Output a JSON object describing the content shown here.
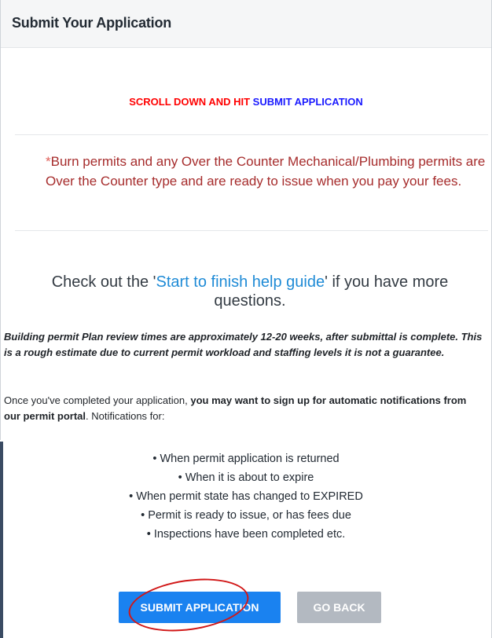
{
  "header": {
    "title": "Submit Your Application"
  },
  "instruction": {
    "red_text": "SCROLL DOWN AND HIT ",
    "blue_text": "SUBMIT APPLICATION"
  },
  "note": {
    "asterisk": "*",
    "text": "Burn permits and any Over the Counter Mechanical/Plumbing permits are Over the Counter type and are ready to issue when you pay your fees."
  },
  "help": {
    "prefix": "Check out the '",
    "link_text": "Start to finish help guide",
    "suffix": "' if you have more questions."
  },
  "review_notice": "Building permit Plan review times are approximately 12-20 weeks, after submittal is complete. This is a rough estimate due to current permit workload and staffing levels it is not a guarantee.",
  "signup": {
    "prefix": "Once you've completed your application, ",
    "bold": "you may want to sign up for automatic notifications from our permit portal",
    "suffix": ". Notifications for:"
  },
  "notifications": [
    "When permit application is returned",
    "When it is about to expire",
    "When permit state has changed to EXPIRED",
    "Permit is ready to issue, or has fees due",
    "Inspections have been completed etc."
  ],
  "buttons": {
    "submit": "SUBMIT APPLICATION",
    "back": "GO BACK"
  },
  "colors": {
    "instruction_red": "#ff0000",
    "instruction_blue": "#1a1aff",
    "note_text": "#a62c2c",
    "link": "#1f8bd6",
    "submit_button": "#1a82f0",
    "back_button": "#b3b9c1",
    "annotation_circle": "#d11717"
  }
}
